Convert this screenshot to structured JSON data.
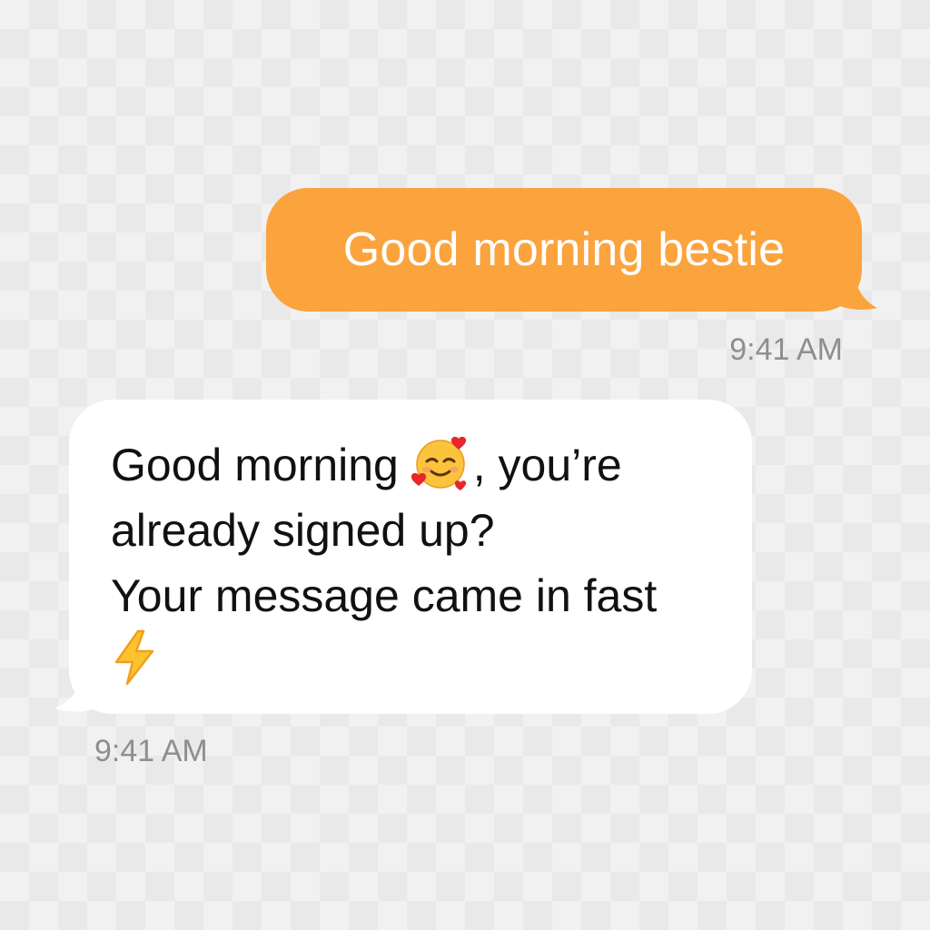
{
  "thread": {
    "outgoing": {
      "text": "Good morning bestie",
      "time": "9:41 AM",
      "bubble_color": "#fba33d"
    },
    "incoming": {
      "line1_a": "Good morning ",
      "emoji1": "smiling-face-with-hearts-icon",
      "line1_b": ", you’re",
      "line2": "already signed up?",
      "line3": "Your message came in fast",
      "emoji2": "high-voltage-icon",
      "time": "9:41 AM",
      "bubble_color": "#ffffff"
    }
  }
}
